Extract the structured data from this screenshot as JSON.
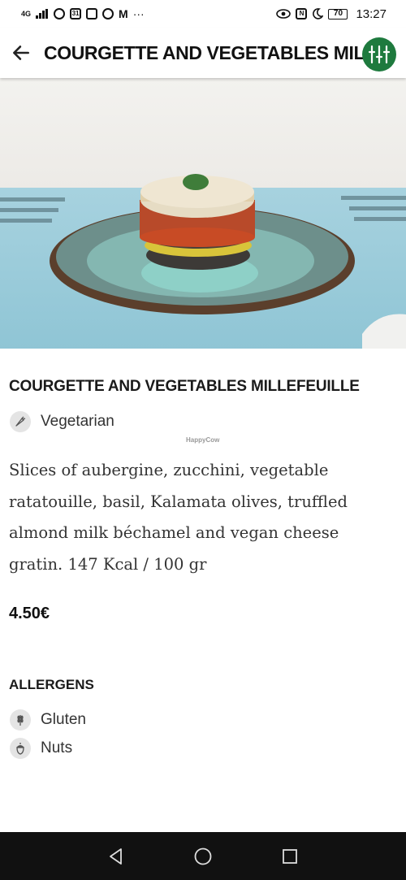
{
  "status_bar": {
    "network_label": "4G",
    "battery_level": "70",
    "time": "13:27"
  },
  "header": {
    "title": "COURGETTE AND VEGETABLES MILLEFEUILLE"
  },
  "dish": {
    "title": "COURGETTE AND VEGETABLES MILLEFEUILLE",
    "tag": "Vegetarian",
    "watermark": "HappyCow",
    "description": "Slices of aubergine, zucchini, vegetable ratatouille, basil, Kalamata olives, truffled almond milk béchamel and vegan cheese gratin. 147 Kcal / 100 gr",
    "price": "4.50€"
  },
  "allergens": {
    "title": "ALLERGENS",
    "items": [
      {
        "label": "Gluten",
        "icon": "wheat-icon"
      },
      {
        "label": "Nuts",
        "icon": "acorn-icon"
      }
    ]
  },
  "colors": {
    "brand_green": "#1e7a3e",
    "nav_bar": "#111111"
  }
}
